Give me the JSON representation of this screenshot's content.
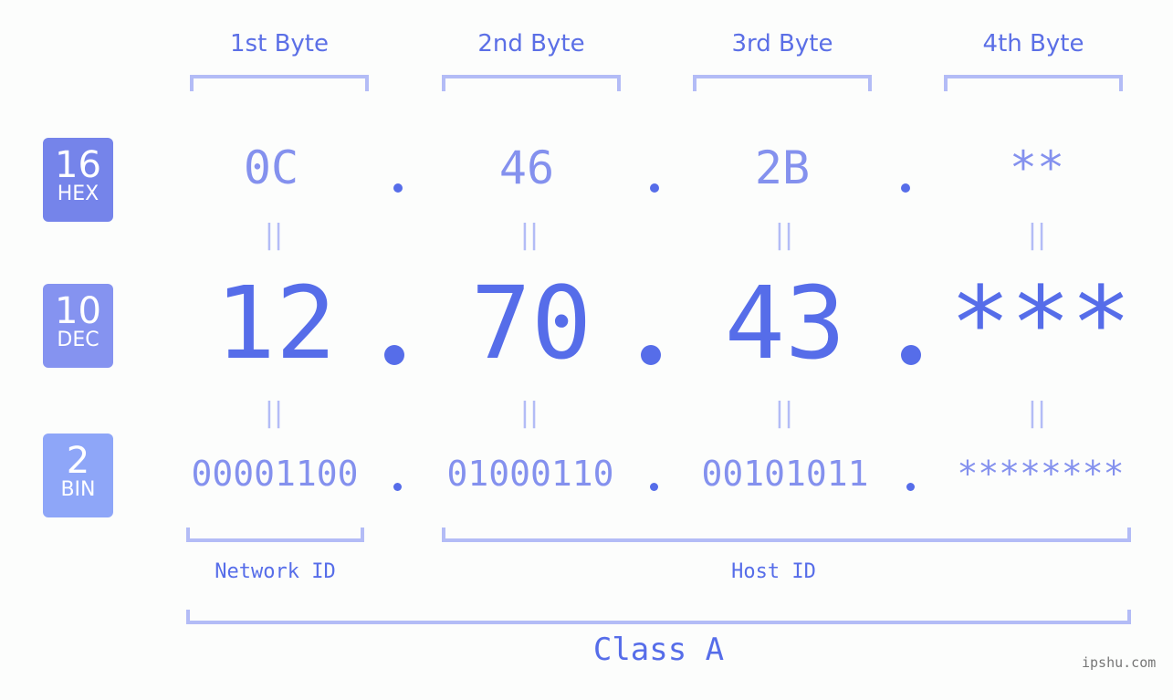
{
  "headers": [
    "1st Byte",
    "2nd Byte",
    "3rd Byte",
    "4th Byte"
  ],
  "badges": [
    {
      "num": "16",
      "label": "HEX",
      "color": "#7584ea"
    },
    {
      "num": "10",
      "label": "DEC",
      "color": "#8593f0"
    },
    {
      "num": "2",
      "label": "BIN",
      "color": "#8ea6f8"
    }
  ],
  "hex": [
    "0C",
    "46",
    "2B",
    "**"
  ],
  "dec": [
    "12",
    "70",
    "43",
    "***"
  ],
  "bin": [
    "00001100",
    "01000110",
    "00101011",
    "********"
  ],
  "separator": ".",
  "equals": "||",
  "labels": {
    "network": "Network ID",
    "host": "Host ID",
    "class": "Class A"
  },
  "watermark": "ipshu.com",
  "colors": {
    "accent": "#566de9",
    "light": "#8491ee",
    "bracket": "#b3bcf6"
  }
}
